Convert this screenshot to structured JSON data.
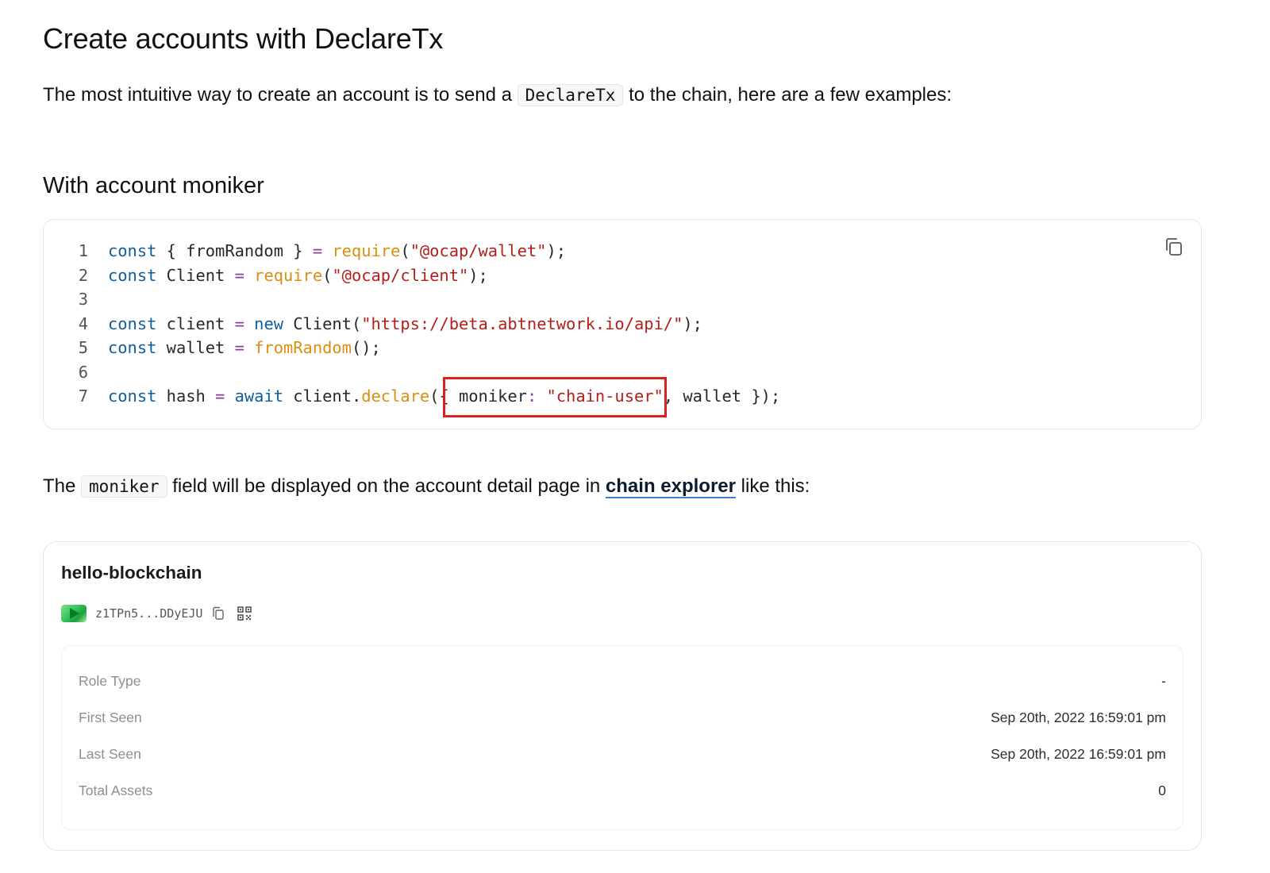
{
  "heading": "Create accounts with DeclareTx",
  "intro": {
    "before": "The most intuitive way to create an account is to send a",
    "code": "DeclareTx",
    "after": "to the chain, here are a few examples:"
  },
  "section_heading": "With account moniker",
  "code_block": {
    "copy_icon": "copy-icon",
    "line_numbers": [
      "1",
      "2",
      "3",
      "4",
      "5",
      "6",
      "7"
    ],
    "lines": [
      [
        [
          "kw",
          "const"
        ],
        [
          "",
          " { fromRandom } "
        ],
        [
          "op",
          "="
        ],
        [
          "",
          " "
        ],
        [
          "fn",
          "require"
        ],
        [
          "",
          "("
        ],
        [
          "str",
          "\"@ocap/wallet\""
        ],
        [
          "",
          ");"
        ]
      ],
      [
        [
          "kw",
          "const"
        ],
        [
          "",
          " Client "
        ],
        [
          "op",
          "="
        ],
        [
          "",
          " "
        ],
        [
          "fn",
          "require"
        ],
        [
          "",
          "("
        ],
        [
          "str",
          "\"@ocap/client\""
        ],
        [
          "",
          ");"
        ]
      ],
      [],
      [
        [
          "kw",
          "const"
        ],
        [
          "",
          " client "
        ],
        [
          "op",
          "="
        ],
        [
          "",
          " "
        ],
        [
          "kw",
          "new"
        ],
        [
          "",
          " Client("
        ],
        [
          "str",
          "\"https://beta.abtnetwork.io/api/\""
        ],
        [
          "",
          ");"
        ]
      ],
      [
        [
          "kw",
          "const"
        ],
        [
          "",
          " wallet "
        ],
        [
          "op",
          "="
        ],
        [
          "",
          " "
        ],
        [
          "fn",
          "fromRandom"
        ],
        [
          "",
          "();"
        ]
      ],
      [],
      [
        [
          "kw",
          "const"
        ],
        [
          "",
          " hash "
        ],
        [
          "op",
          "="
        ],
        [
          "",
          " "
        ],
        [
          "kw",
          "await"
        ],
        [
          "",
          " client."
        ],
        [
          "fn",
          "declare"
        ],
        [
          "",
          "({ moniker"
        ],
        [
          "op",
          ":"
        ],
        [
          "",
          " "
        ],
        [
          "str",
          "\"chain-user\""
        ],
        [
          "",
          ", wallet });"
        ]
      ]
    ]
  },
  "para2": {
    "before": "The",
    "code": "moniker",
    "middle": "field will be displayed on the account detail page in",
    "link": "chain explorer",
    "after": "like this:"
  },
  "explorer": {
    "account_name": "hello-blockchain",
    "address": "z1TPn5...DDyEJU",
    "rows": [
      {
        "label": "Role Type",
        "value": "-"
      },
      {
        "label": "First Seen",
        "value": "Sep 20th, 2022 16:59:01 pm"
      },
      {
        "label": "Last Seen",
        "value": "Sep 20th, 2022 16:59:01 pm"
      },
      {
        "label": "Total Assets",
        "value": "0"
      }
    ]
  }
}
